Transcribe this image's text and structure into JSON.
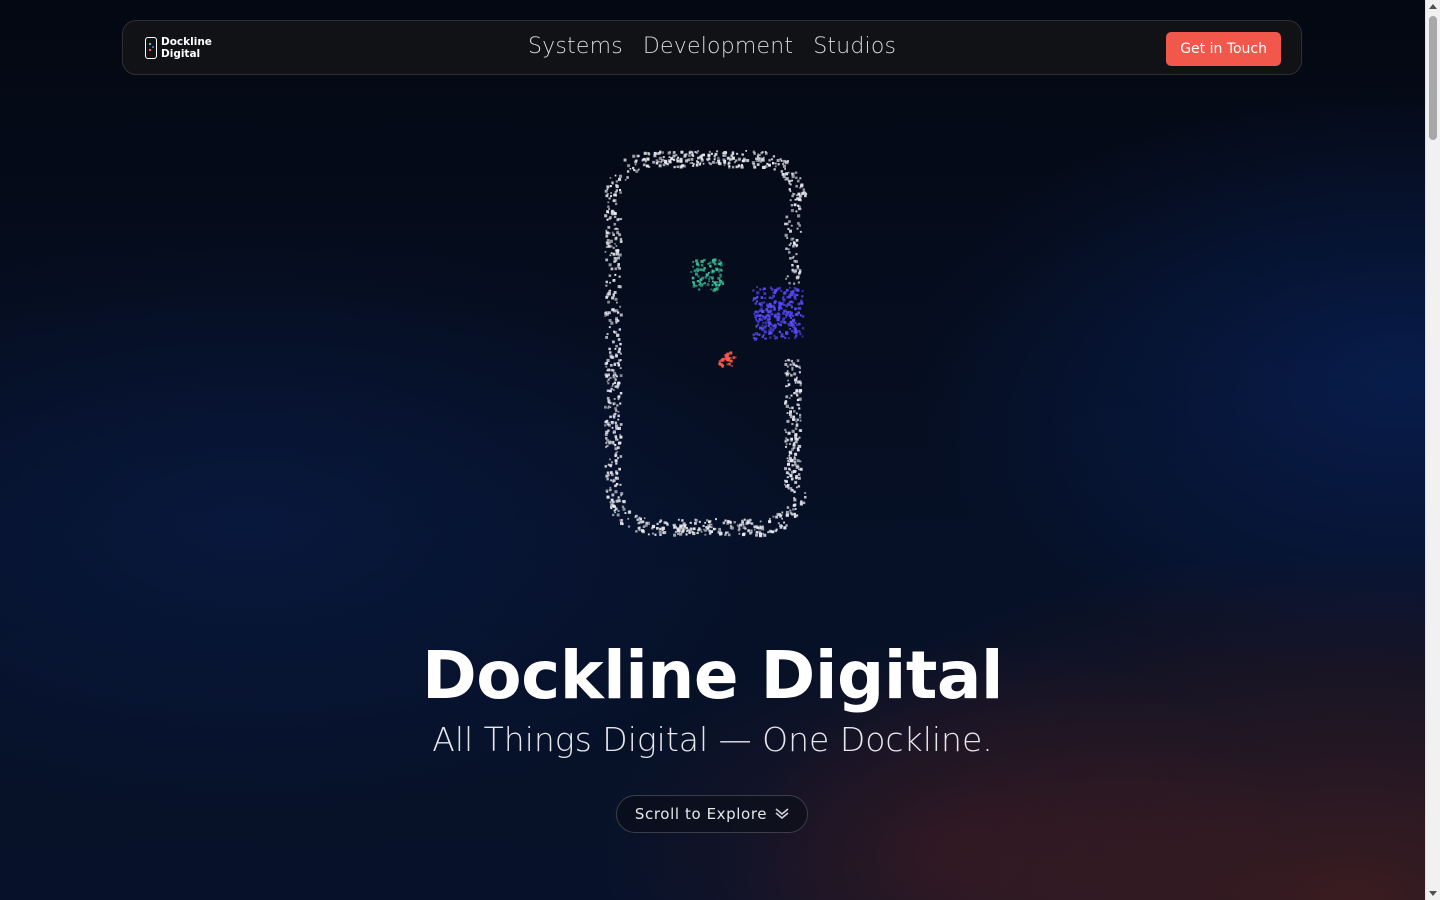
{
  "brand": {
    "name_line1": "Dockline",
    "name_line2": "Digital",
    "accent_colors": [
      "#3ec8a0",
      "#5a4bff",
      "#ff5a4a"
    ]
  },
  "nav": {
    "links": [
      "Systems",
      "Development",
      "Studios"
    ],
    "cta_label": "Get in Touch",
    "cta_color": "#f2574c"
  },
  "hero": {
    "title": "Dockline Digital",
    "subtitle": "All Things Digital — One Dockline.",
    "scroll_label": "Scroll to Explore",
    "scroll_icon": "double-chevron-down-icon"
  },
  "particle_logo": {
    "frame_color": "#e8e8ee",
    "green_color": "#3ec8a0",
    "blue_color": "#5a4bff",
    "red_color": "#ff5a4a"
  }
}
